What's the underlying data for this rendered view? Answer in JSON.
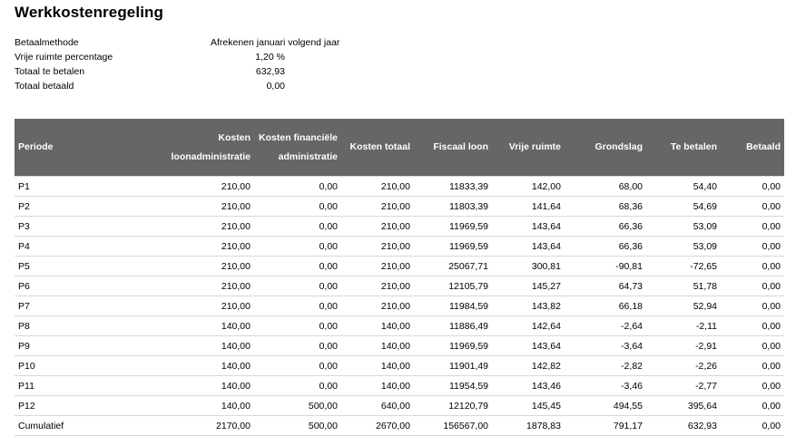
{
  "title": "Werkkostenregeling",
  "summary": [
    {
      "label": "Betaalmethode",
      "value": "Afrekenen januari volgend jaar",
      "align": "left"
    },
    {
      "label": "Vrije ruimte percentage",
      "value": "1,20 %",
      "align": "right"
    },
    {
      "label": "Totaal te betalen",
      "value": "632,93",
      "align": "right"
    },
    {
      "label": "Totaal betaald",
      "value": "0,00",
      "align": "right"
    }
  ],
  "table": {
    "columns": [
      "Periode",
      "Kosten loonadministratie",
      "Kosten financiële administratie",
      "Kosten totaal",
      "Fiscaal loon",
      "Vrije ruimte",
      "Grondslag",
      "Te betalen",
      "Betaald"
    ],
    "rows": [
      [
        "P1",
        "210,00",
        "0,00",
        "210,00",
        "11833,39",
        "142,00",
        "68,00",
        "54,40",
        "0,00"
      ],
      [
        "P2",
        "210,00",
        "0,00",
        "210,00",
        "11803,39",
        "141,64",
        "68,36",
        "54,69",
        "0,00"
      ],
      [
        "P3",
        "210,00",
        "0,00",
        "210,00",
        "11969,59",
        "143,64",
        "66,36",
        "53,09",
        "0,00"
      ],
      [
        "P4",
        "210,00",
        "0,00",
        "210,00",
        "11969,59",
        "143,64",
        "66,36",
        "53,09",
        "0,00"
      ],
      [
        "P5",
        "210,00",
        "0,00",
        "210,00",
        "25067,71",
        "300,81",
        "-90,81",
        "-72,65",
        "0,00"
      ],
      [
        "P6",
        "210,00",
        "0,00",
        "210,00",
        "12105,79",
        "145,27",
        "64,73",
        "51,78",
        "0,00"
      ],
      [
        "P7",
        "210,00",
        "0,00",
        "210,00",
        "11984,59",
        "143,82",
        "66,18",
        "52,94",
        "0,00"
      ],
      [
        "P8",
        "140,00",
        "0,00",
        "140,00",
        "11886,49",
        "142,64",
        "-2,64",
        "-2,11",
        "0,00"
      ],
      [
        "P9",
        "140,00",
        "0,00",
        "140,00",
        "11969,59",
        "143,64",
        "-3,64",
        "-2,91",
        "0,00"
      ],
      [
        "P10",
        "140,00",
        "0,00",
        "140,00",
        "11901,49",
        "142,82",
        "-2,82",
        "-2,26",
        "0,00"
      ],
      [
        "P11",
        "140,00",
        "0,00",
        "140,00",
        "11954,59",
        "143,46",
        "-3,46",
        "-2,77",
        "0,00"
      ],
      [
        "P12",
        "140,00",
        "500,00",
        "640,00",
        "12120,79",
        "145,45",
        "494,55",
        "395,64",
        "0,00"
      ],
      [
        "Cumulatief",
        "2170,00",
        "500,00",
        "2670,00",
        "156567,00",
        "1878,83",
        "791,17",
        "632,93",
        "0,00"
      ]
    ]
  }
}
